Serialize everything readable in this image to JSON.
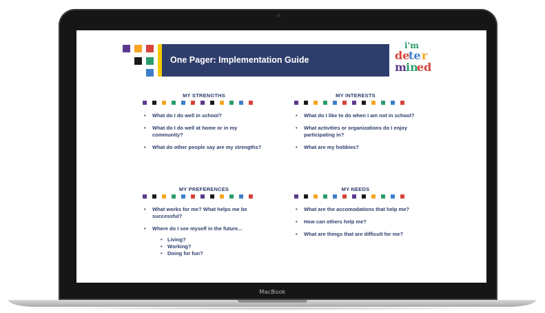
{
  "device": {
    "brand_label": "MacBook"
  },
  "slide": {
    "title": "One Pager: Implementation Guide",
    "logo": {
      "text": "i'm determined"
    },
    "accent_colors": [
      "#5b3a8c",
      "#f5a623",
      "#d7433a",
      "#1a1a1a",
      "#2a9d6a",
      "#3d7ec9"
    ],
    "sections": {
      "strengths": {
        "title": "MY STRENGTHS",
        "items": [
          "What do I do well in school?",
          "What do I do well at home or in my community?",
          "What do other people say are my strengths?"
        ]
      },
      "interests": {
        "title": "MY INTERESTS",
        "items": [
          "What do I like to do when I am not in school?",
          "What activities or organizations do I enjoy participating in?",
          "What are my hobbies?"
        ]
      },
      "preferences": {
        "title": "MY PREFERENCES",
        "items": [
          "What works for me? What helps me be successful?",
          "Where do I see myself in the future..."
        ],
        "subitems": [
          "Living?",
          "Working?",
          "Doing for fun?"
        ]
      },
      "needs": {
        "title": "MY NEEDS",
        "items": [
          "What are the accomodations that help me?",
          "How can others help me?",
          "What are things that are difficult for me?"
        ]
      }
    }
  }
}
